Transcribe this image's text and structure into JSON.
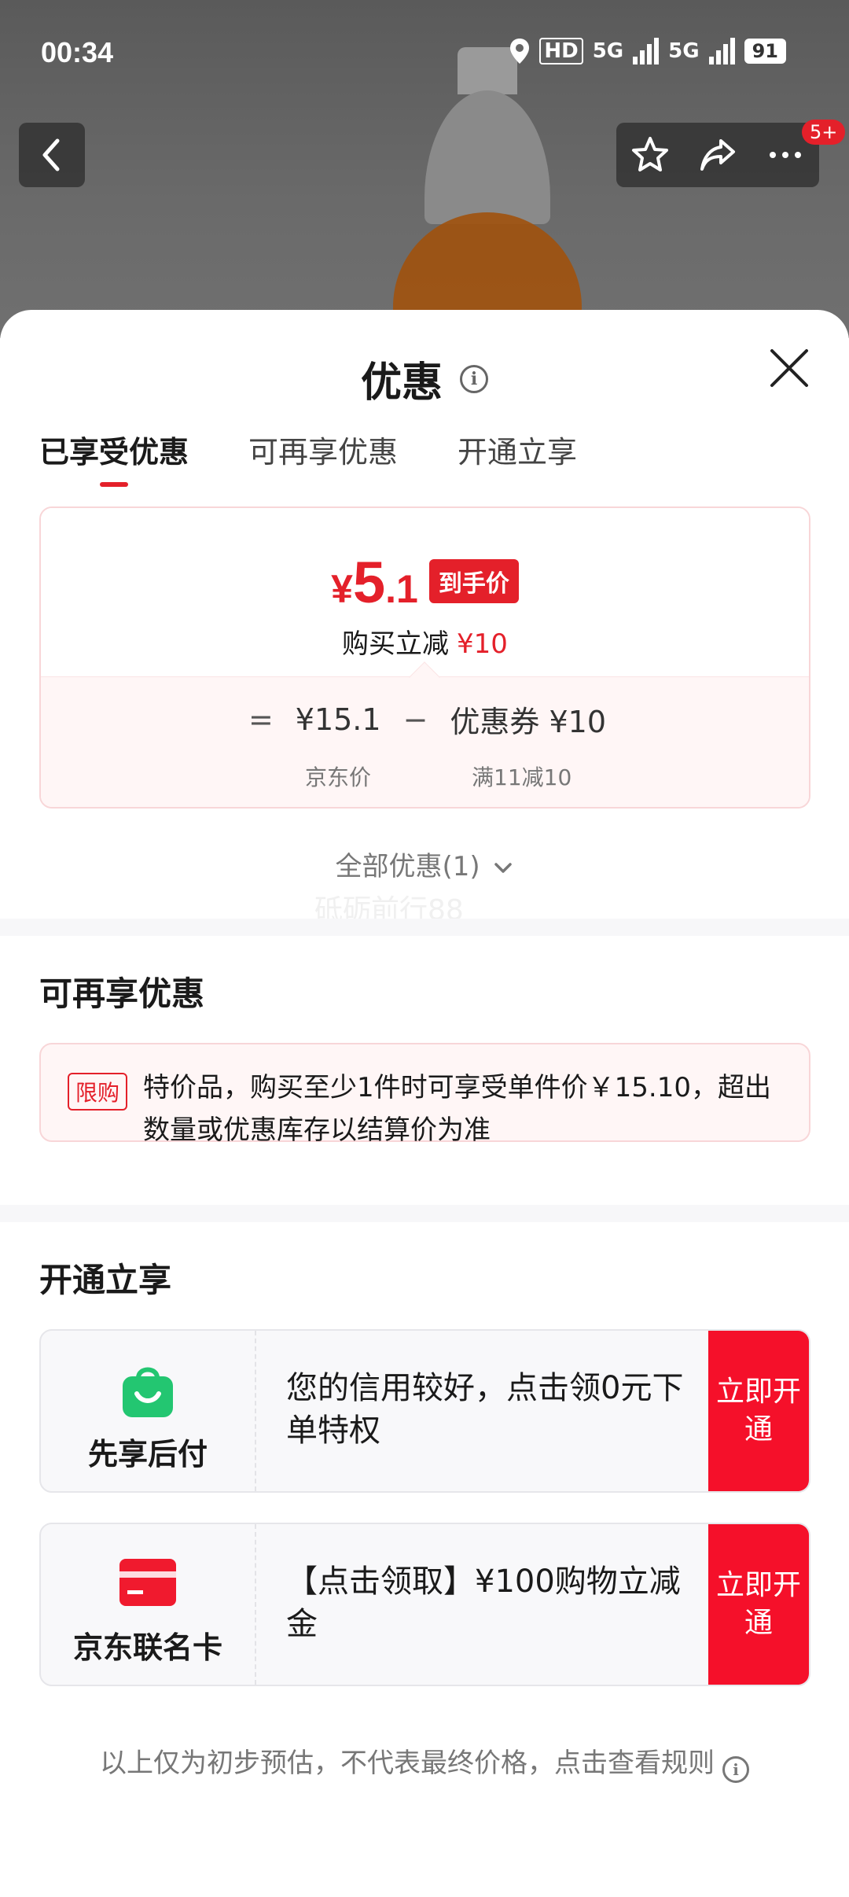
{
  "status_bar": {
    "time": "00:34",
    "hd": "HD",
    "network1": "5G",
    "network2": "5G",
    "battery": "91"
  },
  "header": {
    "badge": "5+"
  },
  "sheet": {
    "title": "优惠",
    "tabs": [
      {
        "label": "已享受优惠",
        "active": true
      },
      {
        "label": "可再享优惠",
        "active": false
      },
      {
        "label": "开通立享",
        "active": false
      }
    ],
    "price_card": {
      "yen": "¥",
      "price_int": "5",
      "price_dec": ".1",
      "final_tag": "到手价",
      "reduce_label": "购买立减",
      "reduce_amount": "¥10",
      "equals": "=",
      "jd_price": "¥15.1",
      "minus": "−",
      "coupon": "优惠券 ¥10",
      "jd_price_label": "京东价",
      "coupon_label": "满11减10"
    },
    "all_deals": "全部优惠(1)",
    "watermark": "砥砺前行88",
    "reapply": {
      "title": "可再享优惠",
      "tag": "限购",
      "text": "特价品，购买至少1件时可享受单件价￥15.10，超出数量或优惠库存以结算价为准"
    },
    "open_now": {
      "title": "开通立享",
      "items": [
        {
          "name": "先享后付",
          "desc": "您的信用较好，点击领0元下单特权",
          "button": "立即开通",
          "icon": "shopping-bag-icon",
          "color": "#23c671"
        },
        {
          "name": "京东联名卡",
          "desc": "【点击领取】¥100购物立减金",
          "button": "立即开通",
          "icon": "credit-card-icon",
          "color": "#f01a2e"
        }
      ]
    },
    "footer_note": "以上仅为初步预估，不代表最终价格，点击查看规则"
  }
}
